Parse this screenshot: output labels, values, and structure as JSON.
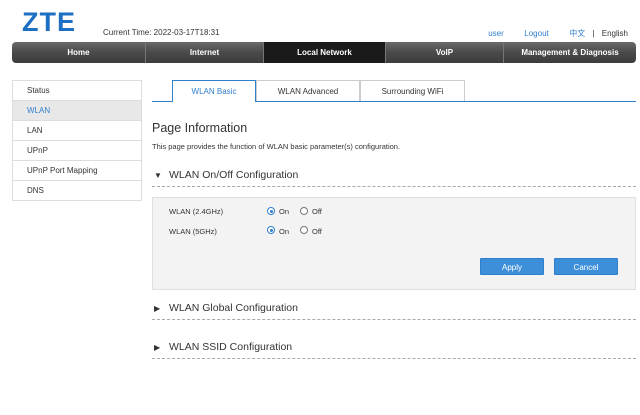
{
  "header": {
    "logo_text": "ZTE",
    "current_time": "Current Time: 2022-03-17T18:31",
    "user_link": "user",
    "logout_link": "Logout",
    "lang_cn": "中文",
    "lang_sep": "|",
    "lang_en": "English"
  },
  "nav": {
    "items": [
      "Home",
      "Internet",
      "Local Network",
      "VoIP",
      "Management & Diagnosis"
    ],
    "active": "Local Network"
  },
  "sidebar": {
    "items": [
      "Status",
      "WLAN",
      "LAN",
      "UPnP",
      "UPnP Port Mapping",
      "DNS"
    ],
    "active": "WLAN"
  },
  "tabs": {
    "items": [
      "WLAN Basic",
      "WLAN Advanced",
      "Surrounding WiFi"
    ],
    "active": "WLAN Basic"
  },
  "page": {
    "title": "Page Information",
    "description": "This page provides the function of WLAN basic parameter(s) configuration."
  },
  "sections": {
    "onoff": "WLAN On/Off Configuration",
    "global": "WLAN Global Configuration",
    "ssid": "WLAN SSID Configuration"
  },
  "onoff_panel": {
    "rows": [
      {
        "label": "WLAN (2.4GHz)",
        "on_label": "On",
        "off_label": "Off",
        "selected": "On"
      },
      {
        "label": "WLAN (5GHz)",
        "on_label": "On",
        "off_label": "Off",
        "selected": "On"
      }
    ],
    "apply_label": "Apply",
    "cancel_label": "Cancel"
  },
  "colors": {
    "accent": "#2f7fcb",
    "button": "#3d8fd9",
    "nav_bg": "#4a4a4a",
    "nav_active": "#1a1a1a",
    "logo": "#1d6fc4"
  },
  "icons": {
    "expanded": "triangle-down-icon",
    "collapsed": "triangle-right-icon"
  }
}
